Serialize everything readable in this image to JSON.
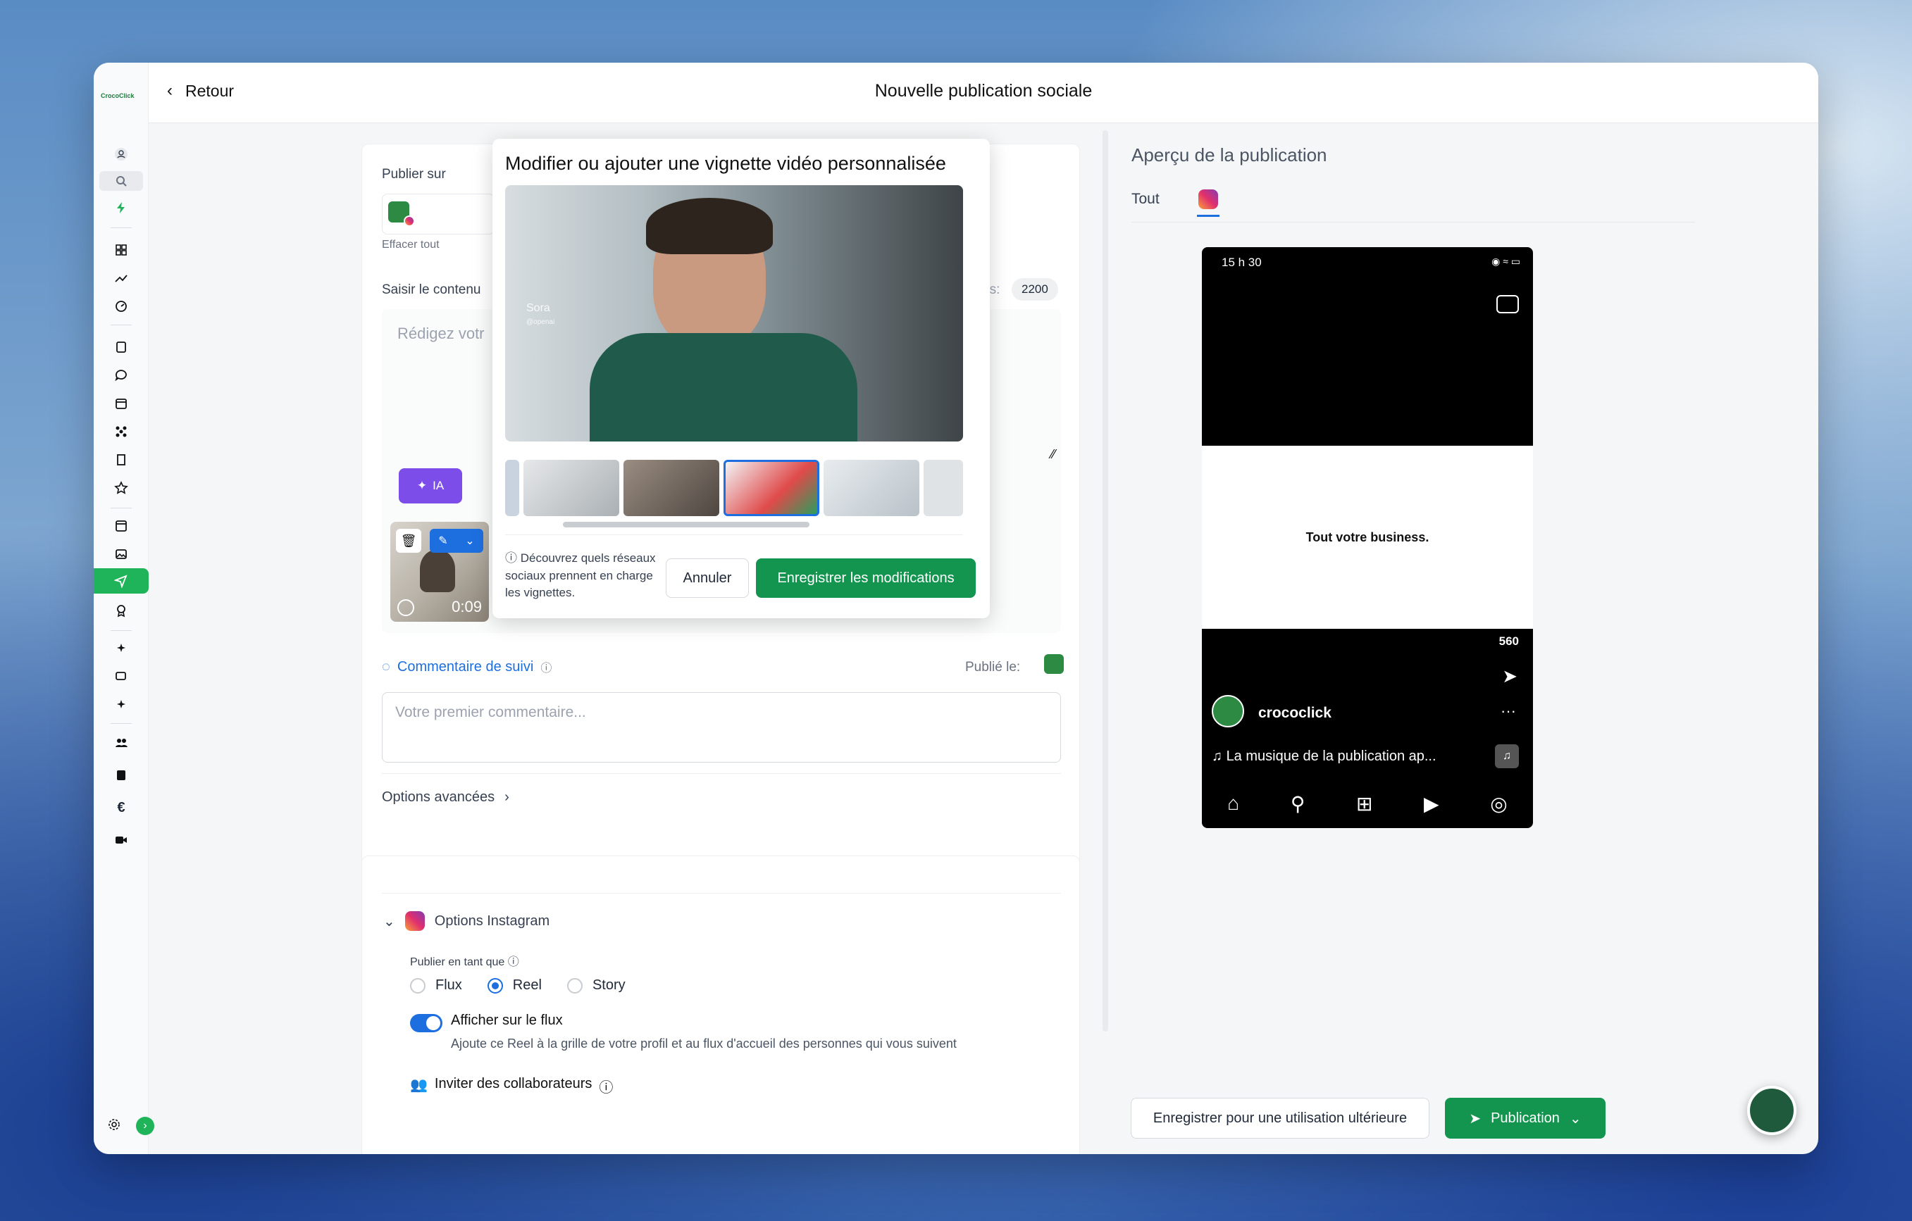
{
  "window": {
    "back_label": "Retour",
    "title": "Nouvelle publication sociale",
    "logo_text": "CrocoClick"
  },
  "editor": {
    "publish_on_label": "Publier sur",
    "clear_all": "Effacer tout",
    "content_label": "Saisir le contenu",
    "chars_label_fragment": "es:",
    "char_count": "2200",
    "placeholder": "Rédigez votr",
    "ai_button": "IA",
    "video_duration": "0:09",
    "followup_label": "Commentaire de suivi",
    "published_on_label": "Publié le:",
    "comment_placeholder": "Votre premier commentaire...",
    "advanced_options": "Options avancées"
  },
  "instagram_options": {
    "title": "Options Instagram",
    "publish_as_label": "Publier en tant que",
    "options": [
      "Flux",
      "Reel",
      "Story"
    ],
    "selected": "Reel",
    "show_in_feed_label": "Afficher sur le flux",
    "show_in_feed_on": true,
    "show_in_feed_desc": "Ajoute ce Reel à la grille de votre profil et au flux d'accueil des personnes qui vous suivent",
    "invite_label": "Inviter des collaborateurs"
  },
  "thumbnail_modal": {
    "title": "Modifier ou ajouter une vignette vidéo personnalisée",
    "watermark": "Sora",
    "watermark_sub": "@openai",
    "info_text": "Découvrez quels réseaux sociaux prennent en charge les vignettes.",
    "cancel": "Annuler",
    "save": "Enregistrer les modifications",
    "thumbnail_count": 6,
    "selected_thumbnail": 3
  },
  "preview": {
    "title": "Aperçu de la publication",
    "tabs": [
      "Tout",
      "instagram"
    ],
    "phone_time": "15 h 30",
    "slide_text": "Tout votre business.",
    "likes": "560",
    "username": "crococlick",
    "music": "La musique de la publication ap..."
  },
  "footer": {
    "save_later": "Enregistrer pour une utilisation ultérieure",
    "publish": "Publication"
  },
  "colors": {
    "accent_green": "#13954f",
    "primary_blue": "#1d6fe0",
    "ai_purple": "#7c4de8"
  }
}
